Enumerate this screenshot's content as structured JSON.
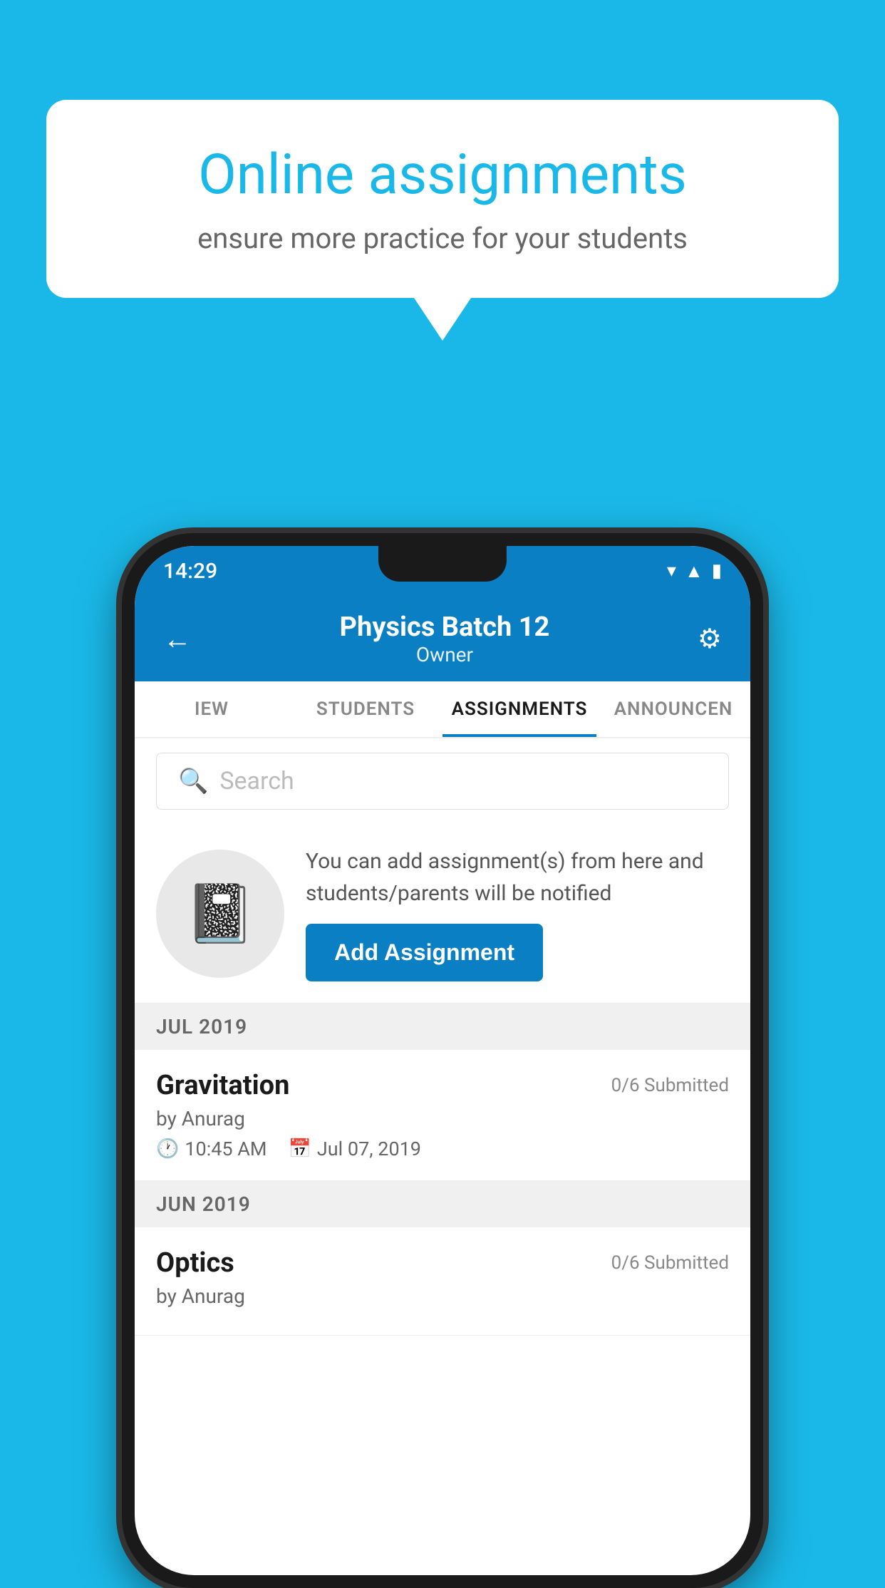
{
  "background_color": "#1ab8e8",
  "speech_bubble": {
    "title": "Online assignments",
    "subtitle": "ensure more practice for your students"
  },
  "status_bar": {
    "time": "14:29",
    "icons": [
      "wifi",
      "signal",
      "battery"
    ]
  },
  "header": {
    "title": "Physics Batch 12",
    "subtitle": "Owner",
    "back_label": "←",
    "settings_label": "⚙"
  },
  "tabs": [
    {
      "label": "IEW",
      "active": false
    },
    {
      "label": "STUDENTS",
      "active": false
    },
    {
      "label": "ASSIGNMENTS",
      "active": true
    },
    {
      "label": "ANNOUNCEN",
      "active": false
    }
  ],
  "search": {
    "placeholder": "Search"
  },
  "promo": {
    "description": "You can add assignment(s) from here and students/parents will be notified",
    "button_label": "Add Assignment"
  },
  "assignments": {
    "sections": [
      {
        "month": "JUL 2019",
        "items": [
          {
            "name": "Gravitation",
            "submitted": "0/6 Submitted",
            "by": "by Anurag",
            "time": "10:45 AM",
            "date": "Jul 07, 2019"
          }
        ]
      },
      {
        "month": "JUN 2019",
        "items": [
          {
            "name": "Optics",
            "submitted": "0/6 Submitted",
            "by": "by Anurag",
            "time": "",
            "date": ""
          }
        ]
      }
    ]
  }
}
